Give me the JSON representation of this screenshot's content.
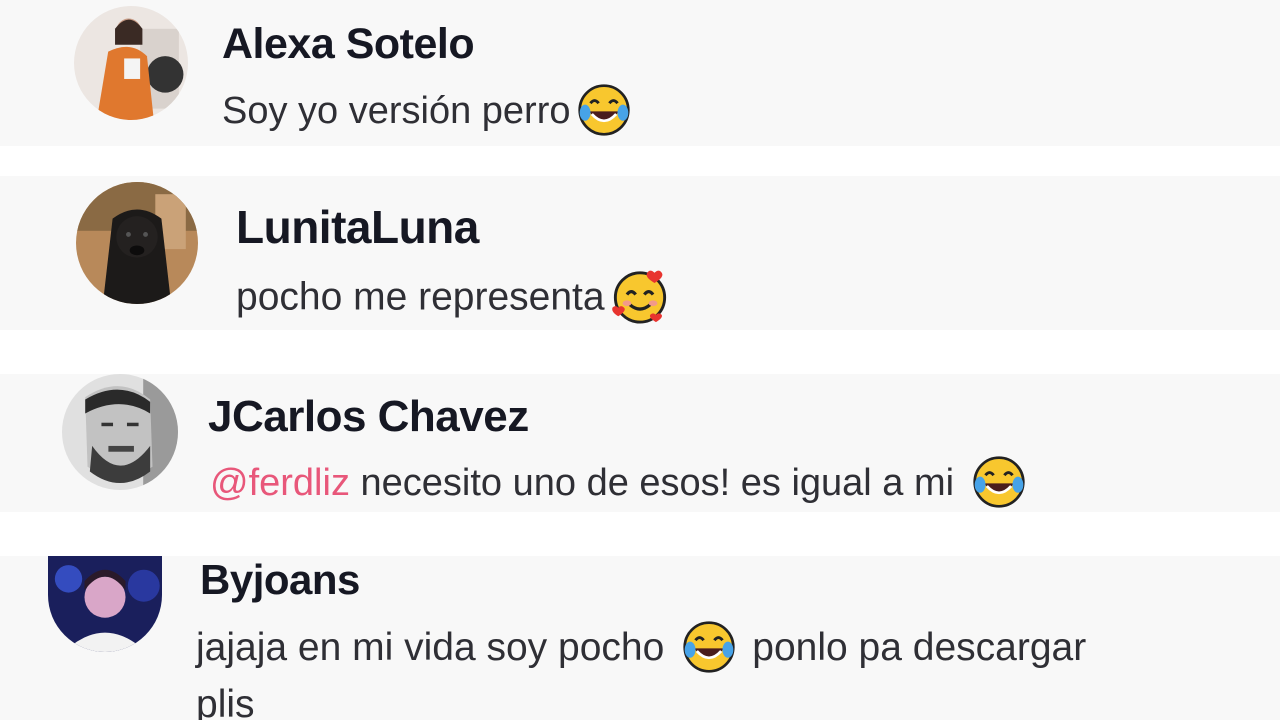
{
  "comments": [
    {
      "username": "Alexa Sotelo",
      "text": "Soy yo versión perro",
      "emoji": "laughing-tears-emoji"
    },
    {
      "username": "LunitaLuna",
      "text": "pocho me representa",
      "emoji": "smiling-face-with-hearts-emoji"
    },
    {
      "username": "JCarlos Chavez",
      "mention": "@ferdliz",
      "text": " necesito uno de esos! es igual a mi",
      "emoji": "laughing-tears-emoji"
    },
    {
      "username": "Byjoans",
      "text_before": "jajaja en mi vida soy pocho",
      "emoji": "laughing-tears-emoji",
      "text_after": "ponlo pa descargar",
      "text_line2": "plis"
    }
  ],
  "colors": {
    "card_background": "#f8f8f8",
    "username": "#161823",
    "comment_text": "#2f2f35",
    "mention": "#e8577a"
  }
}
